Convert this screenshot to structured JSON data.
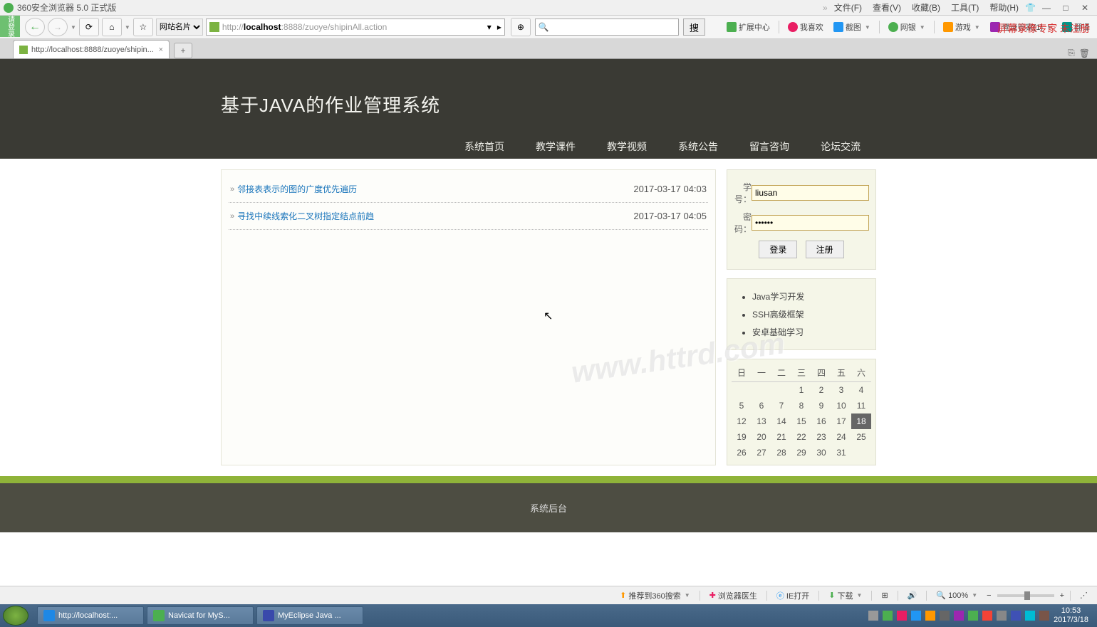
{
  "browser": {
    "title": "360安全浏览器 5.0 正式版",
    "menus": [
      "文件(F)",
      "查看(V)",
      "收藏(B)",
      "工具(T)",
      "帮助(H)"
    ],
    "login_text": "请登录",
    "site_dropdown": "网站名片",
    "url_prefix": "http://",
    "url_bold": "localhost",
    "url_rest": ":8888/zuoye/shipinAll.action",
    "search_placeholder": "",
    "search_btn": "搜",
    "toolbar_links": [
      {
        "label": "扩展中心",
        "color": "#4caf50"
      },
      {
        "label": "我喜欢",
        "color": "#e91e63"
      },
      {
        "label": "截图",
        "color": "#2196f3"
      },
      {
        "label": "网银",
        "color": "#4caf50"
      },
      {
        "label": "游戏",
        "color": "#ff9800"
      },
      {
        "label": "登录管家(1)",
        "color": "#9c27b0"
      },
      {
        "label": "翻译",
        "color": "#009688"
      }
    ],
    "red_overlay": "屏幕录像专家 未注册",
    "tab_title": "http://localhost:8888/zuoye/shipin..."
  },
  "page": {
    "heading": "基于JAVA的作业管理系统",
    "nav": [
      "系统首页",
      "教学课件",
      "教学视频",
      "系统公告",
      "留言咨询",
      "论坛交流"
    ],
    "articles": [
      {
        "title": "邻接表表示的图的广度优先遍历",
        "date": "2017-03-17 04:03"
      },
      {
        "title": "寻找中续线索化二叉树指定结点前趋",
        "date": "2017-03-17 04:05"
      }
    ],
    "watermark": "www.httrd.com",
    "login": {
      "user_label": "学号：",
      "pass_label": "密码：",
      "user_value": "liusan",
      "pass_value": "••••••",
      "login_btn": "登录",
      "register_btn": "注册"
    },
    "links": [
      "Java学习开发",
      "SSH高级框架",
      "安卓基础学习"
    ],
    "calendar": {
      "headers": [
        "日",
        "一",
        "二",
        "三",
        "四",
        "五",
        "六"
      ],
      "weeks": [
        [
          "",
          "",
          "",
          "1",
          "2",
          "3",
          "4"
        ],
        [
          "5",
          "6",
          "7",
          "8",
          "9",
          "10",
          "11"
        ],
        [
          "12",
          "13",
          "14",
          "15",
          "16",
          "17",
          "18"
        ],
        [
          "19",
          "20",
          "21",
          "22",
          "23",
          "24",
          "25"
        ],
        [
          "26",
          "27",
          "28",
          "29",
          "30",
          "31",
          ""
        ]
      ],
      "today": "18"
    },
    "footer": "系统后台"
  },
  "statusbar": {
    "items": [
      "推荐到360搜索",
      "浏览器医生",
      "IE打开",
      "下载"
    ],
    "zoom": "100%"
  },
  "taskbar": {
    "items": [
      {
        "label": "http://localhost:...",
        "color": "#1e88e5"
      },
      {
        "label": "Navicat for MyS...",
        "color": "#4caf50"
      },
      {
        "label": "MyEclipse Java ...",
        "color": "#3949ab"
      }
    ],
    "time": "10:53",
    "date": "2017/3/18"
  }
}
